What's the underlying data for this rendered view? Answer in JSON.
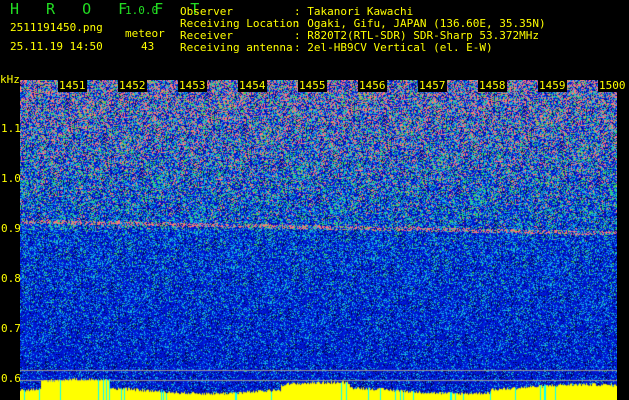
{
  "app": {
    "name": "H R O F F T",
    "version": "1.0.0"
  },
  "file": {
    "name": "2511191450.png",
    "datetime": "25.11.19 14:50"
  },
  "meteor": {
    "label": "meteor",
    "count": "43"
  },
  "info": [
    {
      "key": "Observer",
      "value": ": Takanori Kawachi"
    },
    {
      "key": "Receiving Location",
      "value": ": Ogaki, Gifu, JAPAN (136.60E, 35.35N)"
    },
    {
      "key": "Receiver",
      "value": ": R820T2(RTL-SDR) SDR-Sharp 53.372MHz"
    },
    {
      "key": "Receiving antenna",
      "value": ": 2el-HB9CV Vertical (el. E-W)"
    }
  ],
  "axis": {
    "unit": "kHz",
    "y_ticks": [
      "1.1",
      "1.0",
      "0.9",
      "0.8",
      "0.7",
      "0.6"
    ],
    "x_ticks": [
      "1451",
      "1452",
      "1453",
      "1454",
      "1455",
      "1456",
      "1457",
      "1458",
      "1459",
      "1500"
    ]
  },
  "colors": {
    "text": "#ffff00",
    "logo": "#22dd22",
    "signal_bars": "#ffff00",
    "noise": "#0a1fd0"
  }
}
